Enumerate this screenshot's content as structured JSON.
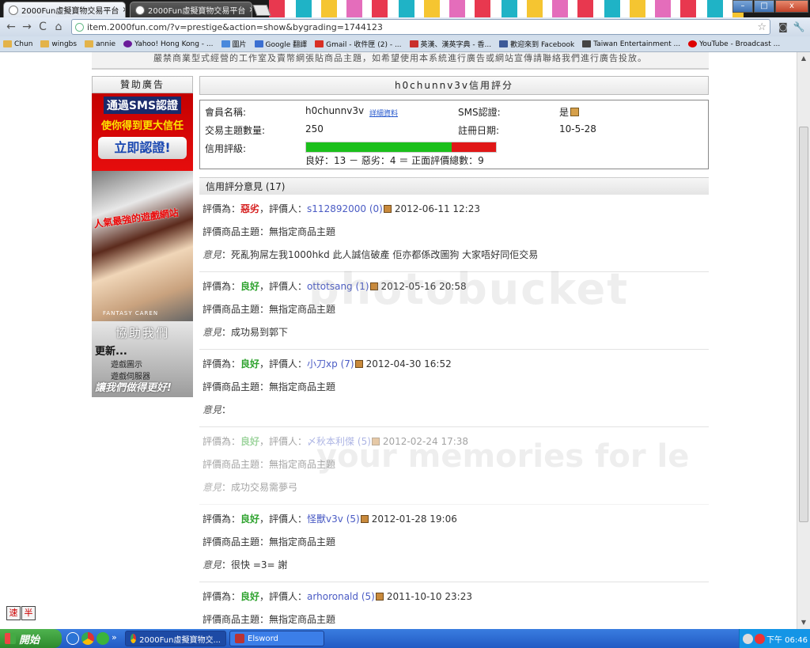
{
  "browser": {
    "tabs": [
      {
        "title": "2000Fun虛擬寶物交易平台",
        "close": "×"
      },
      {
        "title": "2000Fun虛擬寶物交易平台",
        "close": "×"
      }
    ],
    "window_buttons": {
      "minimize": "–",
      "maximize": "□",
      "close": "x"
    },
    "nav": {
      "back": "←",
      "forward": "→",
      "reload": "C",
      "home": "⌂"
    },
    "url": "item.2000fun.com/?v=prestige&action=show&bygrading=1744123",
    "bookmarks": [
      "Chun",
      "wingbs",
      "annie",
      "Yahoo! Hong Kong - ...",
      "圖片",
      "Google 翻譯",
      "Gmail - 收件匣 (2) - ...",
      "英漢、漢英字典 - 香...",
      "歡迎來到 Facebook",
      "Taiwan Entertainment ...",
      "YouTube - Broadcast ..."
    ]
  },
  "page": {
    "notice": "嚴禁商業型式經營的工作室及賣幣網張貼商品主題，如希望使用本系統進行廣告或網站宣傳請聯絡我們進行廣告投放。",
    "sidebar": {
      "title": "贊助廣告",
      "ad_sms": {
        "line1": "通過SMS認證",
        "line2": "使你得到更大信任",
        "cta": "立即認證!"
      },
      "ad_game": {
        "caption": "人氣最強的遊戲網站",
        "logo": "FANTASY CAREN"
      },
      "ad_help": {
        "title": "協助我們",
        "subtitle": "更新...",
        "item1": "遊戲圖示",
        "item2": "遊戲伺服器",
        "slogan": "讓我們做得更好!"
      }
    },
    "profile": {
      "title": "h0chunnv3v信用評分",
      "member_label": "會員名稱:",
      "member_value": "h0chunnv3v",
      "detail_link": "詳細資料",
      "sms_label": "SMS認證:",
      "sms_value": "是",
      "topics_label": "交易主題數量:",
      "topics_value": "250",
      "reg_label": "註冊日期:",
      "reg_value": "10-5-28",
      "rating_label": "信用評級:",
      "rating_summary": "良好：13 － 惡劣：4 ＝ 正面評價總數：9",
      "good": 13,
      "bad": 4
    },
    "comments_header": "信用評分意見 (17)",
    "labels": {
      "eval": "評價為：",
      "rater": "，評價人：",
      "topic": "評價商品主題：",
      "note": "意見",
      "colon": "："
    },
    "reviews": [
      {
        "rating": "惡劣",
        "kind": "bad",
        "rater": "s112892000",
        "score": "(0)",
        "date": "2012-06-11 12:23",
        "topic": "無指定商品主題",
        "note": "死亂狗屌左我1000hkd 此人誠信破產 佢亦都係改圖狗 大家唔好同佢交易"
      },
      {
        "rating": "良好",
        "kind": "good",
        "rater": "ottotsang",
        "score": "(1)",
        "date": "2012-05-16 20:58",
        "topic": "無指定商品主題",
        "note": "成功易到郭下"
      },
      {
        "rating": "良好",
        "kind": "good",
        "rater": "小刀xp",
        "score": "(7)",
        "date": "2012-04-30 16:52",
        "topic": "無指定商品主題",
        "note": ""
      },
      {
        "rating": "良好",
        "kind": "good",
        "rater": "〆秋本利傑",
        "score": "(5)",
        "date": "2012-02-24 17:38",
        "topic": "無指定商品主題",
        "note": "成功交易需夢弓"
      },
      {
        "rating": "良好",
        "kind": "good",
        "rater": "怪獸v3v",
        "score": "(5)",
        "date": "2012-01-28 19:06",
        "topic": "無指定商品主題",
        "note": "很快 =3= 謝"
      },
      {
        "rating": "良好",
        "kind": "good",
        "rater": "arhoronald",
        "score": "(5)",
        "date": "2011-10-10 23:23",
        "topic": "無指定商品主題",
        "note": ""
      }
    ],
    "watermark1": "photobucket",
    "watermark2": "your memories for le",
    "ime": [
      "速",
      "半"
    ]
  },
  "taskbar": {
    "start": "開始",
    "more": "»",
    "tasks": [
      "2000Fun虛擬寶物交...",
      "Elsword"
    ],
    "clock": "下午 06:46"
  }
}
